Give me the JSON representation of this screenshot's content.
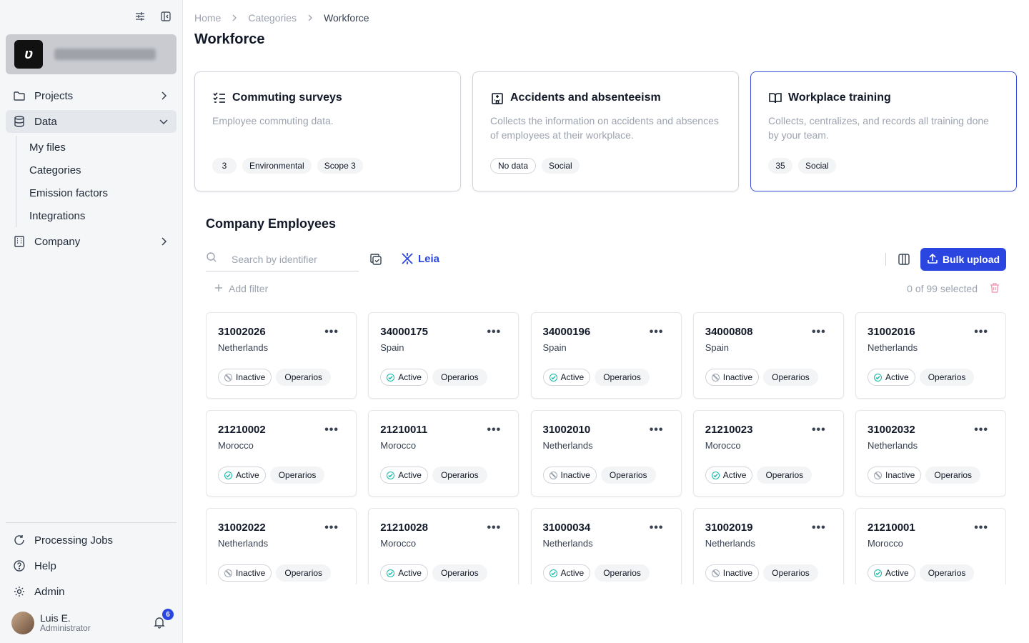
{
  "sidebar": {
    "nav": [
      {
        "label": "Projects",
        "icon": "folder-icon",
        "expanded": false
      },
      {
        "label": "Data",
        "icon": "database-icon",
        "expanded": true
      },
      {
        "label": "Company",
        "icon": "building-icon",
        "expanded": false
      }
    ],
    "data_sub": [
      "My files",
      "Categories",
      "Emission factors",
      "Integrations"
    ],
    "bottom": [
      {
        "label": "Processing Jobs",
        "icon": "refresh-icon"
      },
      {
        "label": "Help",
        "icon": "help-icon"
      },
      {
        "label": "Admin",
        "icon": "gear-icon"
      }
    ],
    "user": {
      "name": "Luis E.",
      "role": "Administrator",
      "notifications": "6"
    }
  },
  "breadcrumb": [
    "Home",
    "Categories",
    "Workforce"
  ],
  "page_title": "Workforce",
  "categories": [
    {
      "title": "Commuting surveys",
      "icon": "checklist-icon",
      "desc": "Employee commuting data.",
      "tags": [
        "3",
        "Environmental",
        "Scope 3"
      ],
      "selected": false
    },
    {
      "title": "Accidents and absenteeism",
      "icon": "hospital-icon",
      "desc": "Collects the information on accidents and absences of employees at their workplace.",
      "tags": [
        "No data",
        "Social"
      ],
      "selected": false
    },
    {
      "title": "Workplace training",
      "icon": "book-icon",
      "desc": "Collects, centralizes, and records all training done by your team.",
      "tags": [
        "35",
        "Social"
      ],
      "selected": true
    }
  ],
  "section_title": "Company Employees",
  "search": {
    "placeholder": "Search by identifier"
  },
  "leia_label": "Leia",
  "bulk_upload_label": "Bulk upload",
  "add_filter_label": "Add filter",
  "selected_count": "0 of 99 selected",
  "employees": [
    {
      "id": "31002026",
      "country": "Netherlands",
      "status": "Inactive",
      "role": "Operarios"
    },
    {
      "id": "34000175",
      "country": "Spain",
      "status": "Active",
      "role": "Operarios"
    },
    {
      "id": "34000196",
      "country": "Spain",
      "status": "Active",
      "role": "Operarios"
    },
    {
      "id": "34000808",
      "country": "Spain",
      "status": "Inactive",
      "role": "Operarios"
    },
    {
      "id": "31002016",
      "country": "Netherlands",
      "status": "Active",
      "role": "Operarios"
    },
    {
      "id": "21210002",
      "country": "Morocco",
      "status": "Active",
      "role": "Operarios"
    },
    {
      "id": "21210011",
      "country": "Morocco",
      "status": "Active",
      "role": "Operarios"
    },
    {
      "id": "31002010",
      "country": "Netherlands",
      "status": "Inactive",
      "role": "Operarios"
    },
    {
      "id": "21210023",
      "country": "Morocco",
      "status": "Active",
      "role": "Operarios"
    },
    {
      "id": "31002032",
      "country": "Netherlands",
      "status": "Inactive",
      "role": "Operarios"
    },
    {
      "id": "31002022",
      "country": "Netherlands",
      "status": "Inactive",
      "role": "Operarios"
    },
    {
      "id": "21210028",
      "country": "Morocco",
      "status": "Active",
      "role": "Operarios"
    },
    {
      "id": "31000034",
      "country": "Netherlands",
      "status": "Active",
      "role": "Operarios"
    },
    {
      "id": "31002019",
      "country": "Netherlands",
      "status": "Inactive",
      "role": "Operarios"
    },
    {
      "id": "21210001",
      "country": "Morocco",
      "status": "Active",
      "role": "Operarios"
    }
  ],
  "colors": {
    "accent": "#2b45e0",
    "active": "#14b8a6",
    "inactive": "#9ca3af"
  }
}
